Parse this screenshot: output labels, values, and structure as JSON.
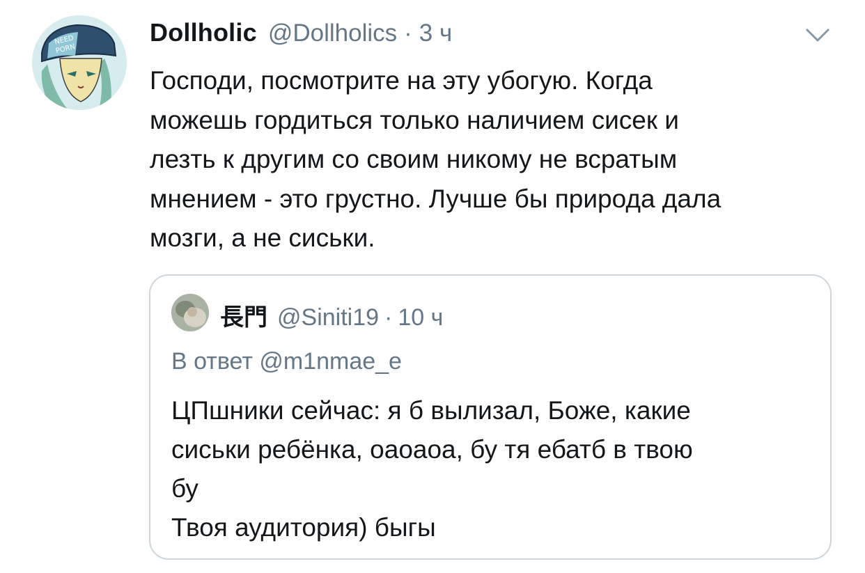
{
  "tweet": {
    "author": {
      "display_name": "Dollholic",
      "handle": "@Dollholics",
      "avatar_icon": "anime-avatar-icon"
    },
    "separator": "·",
    "time": "3 ч",
    "menu_icon": "chevron-down-icon",
    "text_lines": [
      "Господи, посмотрите на эту убогую. Когда",
      "можешь гордиться только наличием сисек и",
      "лезть к другим со своим никому не всратым",
      "мнением - это грустно. Лучше бы природа дала",
      "мозги, а не сиськи."
    ]
  },
  "quoted_tweet": {
    "author": {
      "display_name": "長門",
      "handle": "@Siniti19",
      "avatar_icon": "photo-avatar-icon"
    },
    "separator": "·",
    "time": "10 ч",
    "reply_context": "В ответ @m1nmae_e",
    "text_lines": [
      "ЦПшники сейчас: я б вылизал, Боже, какие",
      "сиськи ребёнка, оаоаоа, бу тя ебатб в твою",
      "бу",
      "Твоя аудитория) быгы"
    ]
  },
  "colors": {
    "text_primary": "#14171a",
    "text_secondary": "#657786",
    "quote_border": "#ccd6dd"
  }
}
